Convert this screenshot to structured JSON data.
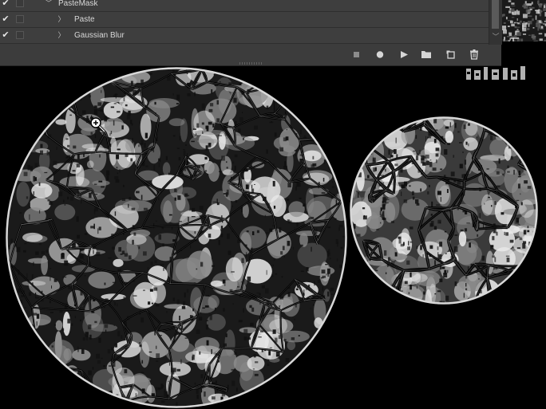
{
  "actions_panel": {
    "rows": [
      {
        "label": "PasteMask",
        "checked": true,
        "expanded": true,
        "indent": 0
      },
      {
        "label": "Paste",
        "checked": true,
        "expanded": false,
        "indent": 1
      },
      {
        "label": "Gaussian Blur",
        "checked": true,
        "expanded": false,
        "indent": 1
      }
    ],
    "toolbar_icons": [
      "stop-icon",
      "record-icon",
      "play-icon",
      "folder-icon",
      "new-action-icon",
      "trash-icon"
    ]
  },
  "canvas": {
    "background": "#000000",
    "pattern_colors": {
      "light": "#e8e8e8",
      "mid": "#8a8a8a",
      "dark": "#101010"
    }
  },
  "cursor": {
    "icon": "zoom-in-icon"
  }
}
